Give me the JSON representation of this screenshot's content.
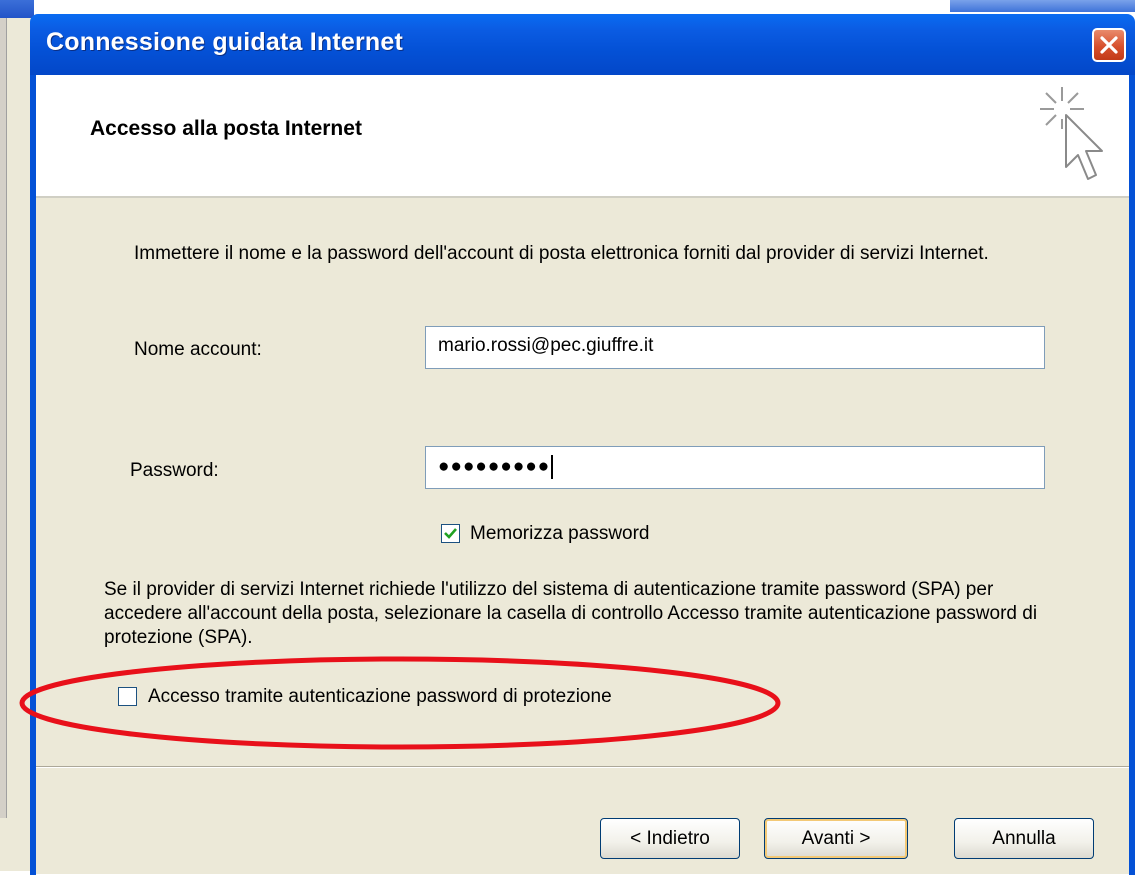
{
  "window": {
    "title": "Connessione guidata Internet",
    "close_icon": "close-icon"
  },
  "header": {
    "title": "Accesso alla posta Internet",
    "icon": "wizard-cursor-sparkle-icon"
  },
  "form": {
    "intro": "Immettere il nome e la password dell'account di posta elettronica forniti dal provider di servizi Internet.",
    "account_label": "Nome account:",
    "account_value": "mario.rossi@pec.giuffre.it",
    "password_label": "Password:",
    "password_value": "●●●●●●●●●",
    "remember_label": "Memorizza password",
    "remember_checked": true,
    "spa_description": "Se il provider di servizi Internet richiede l'utilizzo del sistema di autenticazione tramite password (SPA) per accedere all'account della posta, selezionare la casella di controllo Accesso tramite autenticazione password di protezione (SPA).",
    "spa_label": "Accesso tramite autenticazione password di protezione",
    "spa_checked": false
  },
  "buttons": {
    "back": "< Indietro",
    "next": "Avanti >",
    "cancel": "Annulla"
  },
  "annotation": {
    "highlight_color": "#e8101a"
  },
  "colors": {
    "titlebar": "#0451d6",
    "dialog_body": "#ece9d8",
    "close_button": "#d7502d"
  }
}
